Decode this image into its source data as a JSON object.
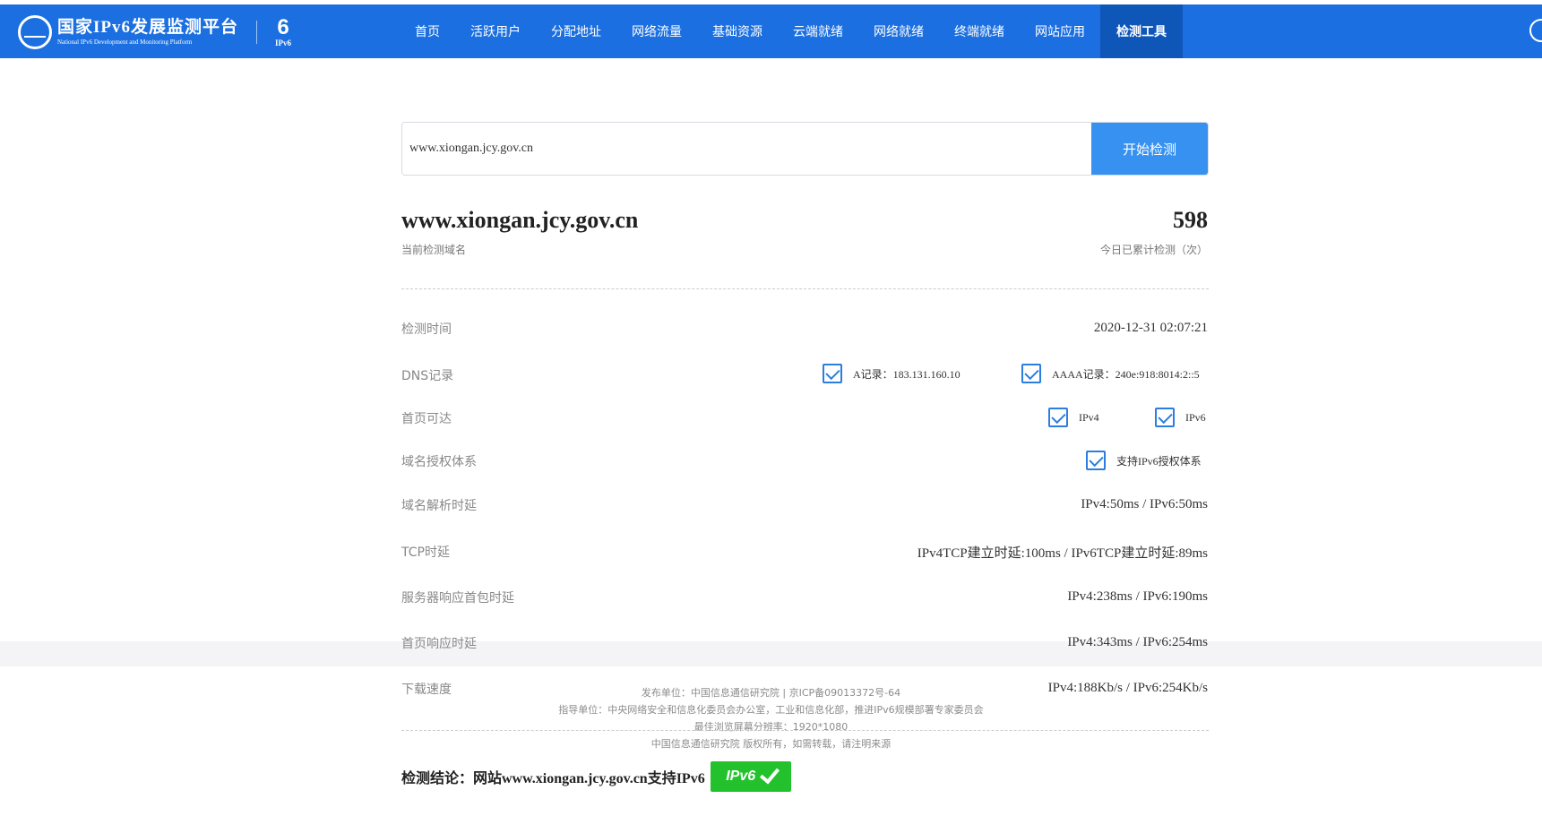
{
  "header": {
    "logo_title": "国家IPv6发展监测平台",
    "logo_subtitle": "National IPv6 Development and Monitoring Platform",
    "ipv6_mark_label": "IPv6",
    "nav": [
      {
        "label": "首页"
      },
      {
        "label": "活跃用户"
      },
      {
        "label": "分配地址"
      },
      {
        "label": "网络流量"
      },
      {
        "label": "基础资源"
      },
      {
        "label": "云端就绪"
      },
      {
        "label": "网络就绪"
      },
      {
        "label": "终端就绪"
      },
      {
        "label": "网站应用"
      },
      {
        "label": "检测工具",
        "active": true
      }
    ],
    "colors": {
      "bar": "#1b6fe0",
      "active": "#0e56b8"
    }
  },
  "search": {
    "value": "www.xiongan.jcy.gov.cn",
    "button_label": "开始检测"
  },
  "summary": {
    "domain": "www.xiongan.jcy.gov.cn",
    "domain_caption": "当前检测域名",
    "count": "598",
    "count_caption": "今日已累计检测（次）"
  },
  "rows": {
    "time": {
      "label": "检测时间",
      "value": "2020-12-31 02:07:21"
    },
    "dns": {
      "label": "DNS记录",
      "a_record": "A记录：183.131.160.10",
      "aaaa_record": "AAAA记录：240e:918:8014:2::5"
    },
    "reachable": {
      "label": "首页可达",
      "ipv4": "IPv4",
      "ipv6": "IPv6"
    },
    "auth": {
      "label": "域名授权体系",
      "value": "支持IPv6授权体系"
    },
    "dns_delay": {
      "label": "域名解析时延",
      "value": "IPv4:50ms / IPv6:50ms"
    },
    "tcp_delay": {
      "label": "TCP时延",
      "value": "IPv4TCP建立时延:100ms / IPv6TCP建立时延:89ms"
    },
    "server_delay": {
      "label": "服务器响应首包时延",
      "value": "IPv4:238ms / IPv6:190ms"
    },
    "page_delay": {
      "label": "首页响应时延",
      "value": "IPv4:343ms / IPv6:254ms"
    },
    "download": {
      "label": "下载速度",
      "value": "IPv4:188Kb/s / IPv6:254Kb/s"
    }
  },
  "footer": {
    "line1": "发布单位：中国信息通信研究院 | 京ICP备09013372号-64",
    "line2": "指导单位：中央网络安全和信息化委员会办公室，工业和信息化部，推进IPv6规模部署专家委员会",
    "line3": "最佳浏览屏幕分辨率：1920*1080",
    "line4": "中国信息通信研究院 版权所有，如需转载，请注明来源"
  },
  "conclusion": {
    "text": "检测结论：网站www.xiongan.jcy.gov.cn支持IPv6",
    "badge": "IPv6",
    "badge_color": "#23c22d"
  }
}
